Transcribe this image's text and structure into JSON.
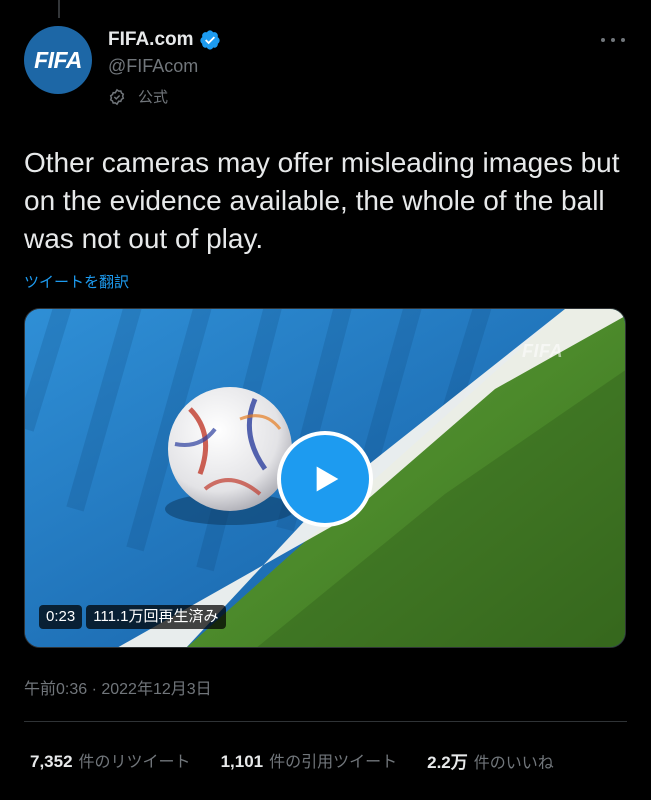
{
  "account": {
    "avatar_text": "FIFA",
    "display_name": "FIFA.com",
    "handle": "@FIFAcom",
    "official_label": "公式"
  },
  "tweet": {
    "text": "Other cameras may offer misleading images but on the evidence available, the whole of the ball was not out of play.",
    "translate_label": "ツイートを翻訳",
    "timestamp": "午前0:36 · 2022年12月3日"
  },
  "video": {
    "duration": "0:23",
    "views": "111.1万回再生済み",
    "watermark": "FIFA"
  },
  "stats": [
    {
      "count": "7,352",
      "label": "件のリツイート"
    },
    {
      "count": "1,101",
      "label": "件の引用ツイート"
    },
    {
      "count": "2.2万",
      "label": "件のいいね"
    }
  ],
  "colors": {
    "background": "#000000",
    "accent": "#1d9bf0",
    "text_primary": "#e7e9ea",
    "text_secondary": "#71767b",
    "avatar_bg": "#1d67a6"
  },
  "icons": {
    "verified": "verified-badge-icon",
    "official": "official-check-icon",
    "more": "more-dots-icon",
    "play": "play-icon"
  }
}
